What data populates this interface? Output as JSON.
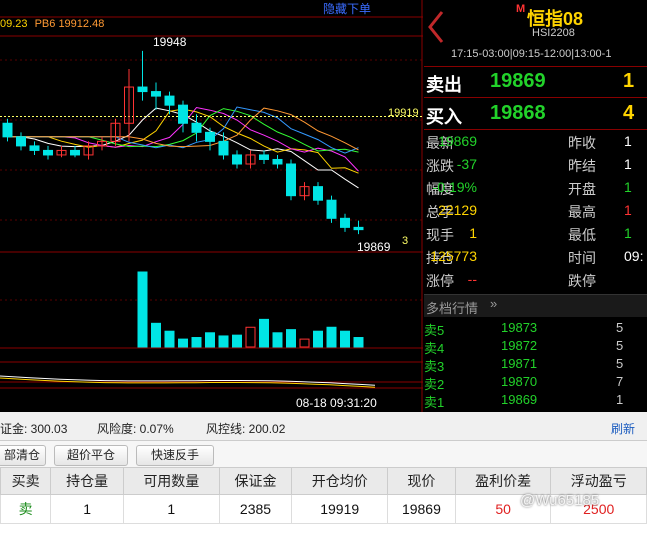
{
  "chart": {
    "hide_link": "隐藏下单",
    "ma_label_prefix": "09.23",
    "ma_label_pb6": "PB6 19912.48",
    "peak_value": "19948",
    "last_value": "19869",
    "right_price_line": "19919",
    "right_tick": "3",
    "datetime": "08-18 09:31:20"
  },
  "chart_data": {
    "type": "candlestick",
    "candles": [
      {
        "open": 19916,
        "close": 19910,
        "high": 19918,
        "low": 19908
      },
      {
        "open": 19910,
        "close": 19906,
        "high": 19912,
        "low": 19904
      },
      {
        "open": 19906,
        "close": 19904,
        "high": 19908,
        "low": 19902
      },
      {
        "open": 19904,
        "close": 19902,
        "high": 19906,
        "low": 19900
      },
      {
        "open": 19902,
        "close": 19904,
        "high": 19906,
        "low": 19901
      },
      {
        "open": 19904,
        "close": 19902,
        "high": 19906,
        "low": 19901
      },
      {
        "open": 19902,
        "close": 19906,
        "high": 19908,
        "low": 19900
      },
      {
        "open": 19906,
        "close": 19908,
        "high": 19910,
        "low": 19904
      },
      {
        "open": 19908,
        "close": 19916,
        "high": 19918,
        "low": 19906
      },
      {
        "open": 19916,
        "close": 19932,
        "high": 19940,
        "low": 19908
      },
      {
        "open": 19932,
        "close": 19930,
        "high": 19948,
        "low": 19926
      },
      {
        "open": 19930,
        "close": 19928,
        "high": 19934,
        "low": 19922
      },
      {
        "open": 19928,
        "close": 19924,
        "high": 19930,
        "low": 19920
      },
      {
        "open": 19924,
        "close": 19916,
        "high": 19926,
        "low": 19912
      },
      {
        "open": 19916,
        "close": 19912,
        "high": 19920,
        "low": 19908
      },
      {
        "open": 19912,
        "close": 19908,
        "high": 19914,
        "low": 19904
      },
      {
        "open": 19908,
        "close": 19902,
        "high": 19912,
        "low": 19900
      },
      {
        "open": 19902,
        "close": 19898,
        "high": 19904,
        "low": 19896
      },
      {
        "open": 19898,
        "close": 19902,
        "high": 19904,
        "low": 19896
      },
      {
        "open": 19902,
        "close": 19900,
        "high": 19904,
        "low": 19898
      },
      {
        "open": 19900,
        "close": 19898,
        "high": 19902,
        "low": 19896
      },
      {
        "open": 19898,
        "close": 19884,
        "high": 19900,
        "low": 19882
      },
      {
        "open": 19884,
        "close": 19888,
        "high": 19890,
        "low": 19882
      },
      {
        "open": 19888,
        "close": 19882,
        "high": 19890,
        "low": 19880
      },
      {
        "open": 19882,
        "close": 19874,
        "high": 19884,
        "low": 19872
      },
      {
        "open": 19874,
        "close": 19870,
        "high": 19876,
        "low": 19868
      },
      {
        "open": 19870,
        "close": 19869,
        "high": 19873,
        "low": 19867
      }
    ],
    "volumes": [
      0,
      0,
      0,
      0,
      0,
      0,
      0,
      0,
      0,
      0,
      95,
      30,
      20,
      10,
      12,
      18,
      14,
      15,
      25,
      35,
      18,
      22,
      10,
      20,
      25,
      20,
      12
    ],
    "price_line": 19919,
    "ylim": [
      19860,
      19955
    ]
  },
  "quote": {
    "title": "恒指08",
    "title_badge": "M",
    "code": "HSI2208",
    "session": "17:15-03:00|09:15-12:00|13:00-1",
    "sell_label": "卖出",
    "sell_price": "19869",
    "sell_qty": "1",
    "buy_label": "买入",
    "buy_price": "19868",
    "buy_qty": "4",
    "rows": [
      {
        "l1": "最新",
        "v1": "19869",
        "c1": "green",
        "l2": "昨收",
        "v2": "1",
        "c2": "white"
      },
      {
        "l1": "涨跌",
        "v1": "-37",
        "c1": "green",
        "l2": "昨结",
        "v2": "1",
        "c2": "white"
      },
      {
        "l1": "幅度",
        "v1": "-0.19%",
        "c1": "green",
        "l2": "开盘",
        "v2": "1",
        "c2": "green"
      },
      {
        "l1": "总手",
        "v1": "22129",
        "c1": "yellow",
        "l2": "最高",
        "v2": "1",
        "c2": "red"
      },
      {
        "l1": "现手",
        "v1": "1",
        "c1": "yellow",
        "l2": "最低",
        "v2": "1",
        "c2": "green"
      },
      {
        "l1": "持仓",
        "v1": "125773",
        "c1": "yellow",
        "l2": "时间",
        "v2": "09:",
        "c2": "white"
      },
      {
        "l1": "涨停",
        "v1": "--",
        "c1": "red",
        "l2": "跌停",
        "v2": "",
        "c2": "white"
      }
    ],
    "depth_title": "多档行情",
    "book": [
      {
        "label": "卖5",
        "price": "19873",
        "vol": "5"
      },
      {
        "label": "卖4",
        "price": "19872",
        "vol": "5"
      },
      {
        "label": "卖3",
        "price": "19871",
        "vol": "5"
      },
      {
        "label": "卖2",
        "price": "19870",
        "vol": "7"
      },
      {
        "label": "卖1",
        "price": "19869",
        "vol": "1"
      }
    ]
  },
  "account": {
    "margin": "证金: 300.03",
    "risk": "风险度: 0.07%",
    "control": "风控线: 200.02",
    "refresh": "刷新"
  },
  "buttons": {
    "close_all": "部清仓",
    "super_close": "超价平仓",
    "quick_reverse": "快速反手"
  },
  "table": {
    "headers": [
      "买卖",
      "持仓量",
      "可用数量",
      "保证金",
      "开仓均价",
      "现价",
      "盈利价差",
      "浮动盈亏"
    ],
    "rows": [
      [
        "卖",
        "1",
        "1",
        "2385",
        "19919",
        "19869",
        "50",
        "2500"
      ]
    ]
  },
  "watermark": "@Wu65185"
}
